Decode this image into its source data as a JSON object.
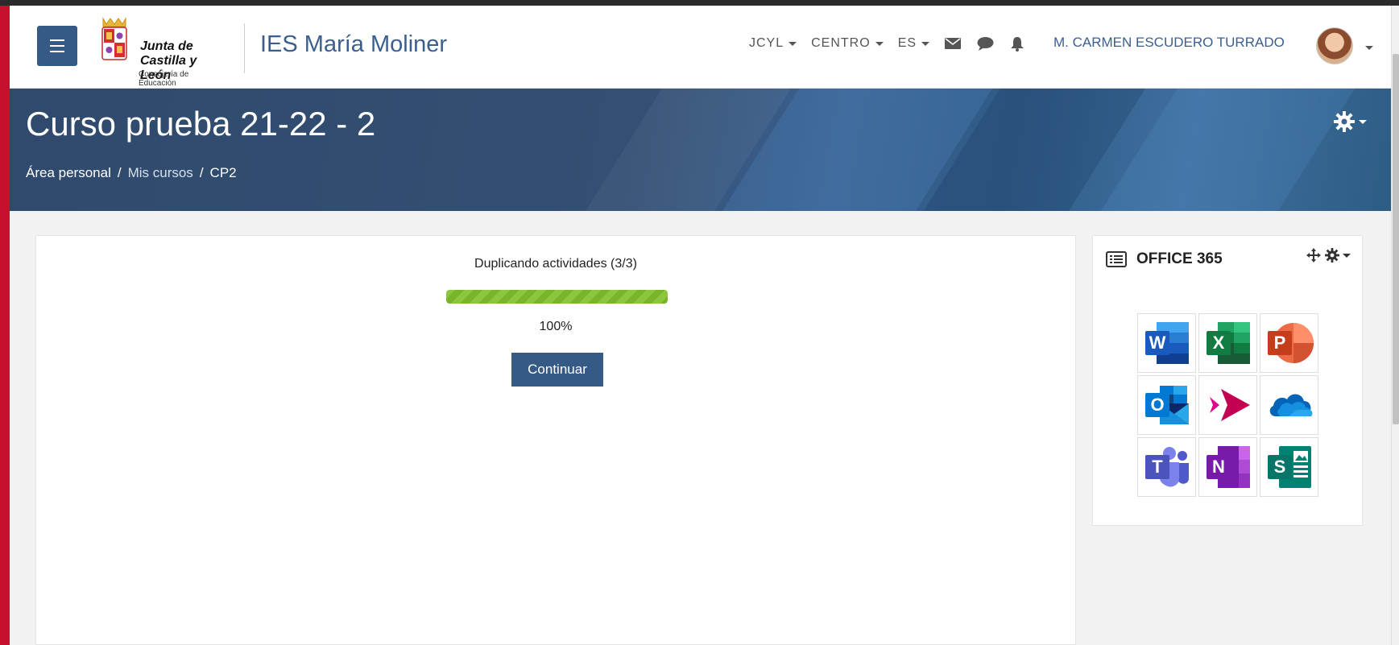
{
  "navbar": {
    "menu_icon": "hamburger-icon",
    "logo": {
      "line1": "Junta de",
      "line2": "Castilla y León",
      "subline": "Consejería de Educación"
    },
    "site_name": "IES María Moliner",
    "menus": [
      {
        "label": "JCYL"
      },
      {
        "label": "CENTRO"
      },
      {
        "label": "ES"
      }
    ],
    "icons": [
      "envelope-icon",
      "chat-bubble-icon",
      "bell-icon"
    ],
    "user_name": "M. CARMEN ESCUDERO TURRADO"
  },
  "header": {
    "title": "Curso prueba 21-22 - 2",
    "breadcrumb": [
      "Área personal",
      "Mis cursos",
      "CP2"
    ],
    "separator": "/"
  },
  "main": {
    "progress_label": "Duplicando actividades (3/3)",
    "progress_value": 1.0,
    "progress_text": "100%",
    "continue_label": "Continuar"
  },
  "sidebar": {
    "block_title": "OFFICE 365",
    "apps": [
      "Word",
      "Excel",
      "PowerPoint",
      "Outlook",
      "Stream",
      "OneDrive",
      "Teams",
      "OneNote",
      "Sway"
    ]
  },
  "colors": {
    "primary": "#345a85",
    "banner": "#2f4a6d",
    "progress": "#8cc63f",
    "accent_edge": "#c8102e"
  }
}
